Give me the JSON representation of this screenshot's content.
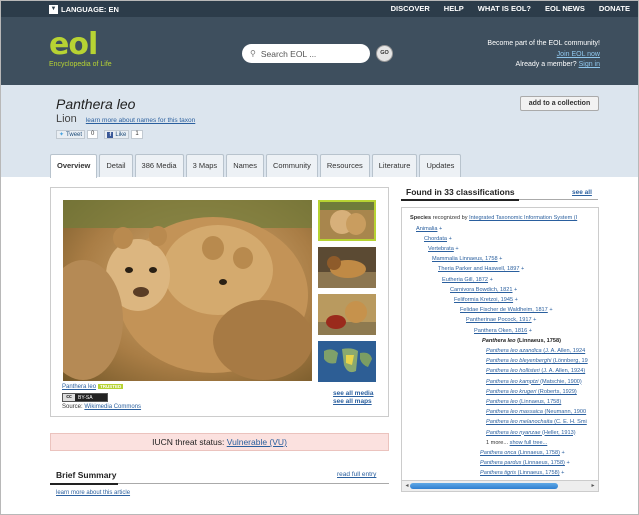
{
  "topbar": {
    "language_label": "LANGUAGE: EN",
    "nav": [
      "DISCOVER",
      "HELP",
      "WHAT IS EOL?",
      "EOL NEWS",
      "DONATE"
    ]
  },
  "banner": {
    "logo_word": "eol",
    "logo_tagline": "Encyclopedia of Life",
    "search_placeholder": "Search EOL ...",
    "go_label": "GO",
    "join_line1": "Become part of the EOL community!",
    "join_link": "Join EOL now",
    "member_prefix": "Already a member?",
    "signin_link": "Sign in"
  },
  "taxon": {
    "scientific_name": "Panthera leo",
    "common_name": "Lion",
    "names_link": "learn more about names for this taxon",
    "tweet_label": "Tweet",
    "tweet_count": "0",
    "like_label": "Like",
    "like_count": "1",
    "add_collection": "add to a collection"
  },
  "tabs": [
    "Overview",
    "Detail",
    "386 Media",
    "3 Maps",
    "Names",
    "Community",
    "Resources",
    "Literature",
    "Updates"
  ],
  "media": {
    "image_name": "Panthera leo",
    "trusted_badge": "TRUSTED",
    "license": "BY-SA",
    "cc_mark": "cc",
    "source_prefix": "Source:",
    "source_link": "Wikimedia Commons",
    "see_all_media": "see all media",
    "see_all_maps": "see all maps"
  },
  "iucn": {
    "label": "IUCN threat status:",
    "status": "Vulnerable (VU)"
  },
  "brief": {
    "title": "Brief Summary",
    "read_full": "read full entry",
    "learn_more": "learn more about this article"
  },
  "classifications": {
    "header": "Found in 33 classifications",
    "see_all": "see all",
    "species_prefix": "Species",
    "species_text": "recognized by",
    "species_link": "Integrated Taxonomic Information System (I",
    "tree": [
      {
        "text": "Animalia",
        "plus": "+"
      },
      {
        "text": "Chordata",
        "plus": "+"
      },
      {
        "text": "Vertebrata",
        "plus": "+"
      },
      {
        "text": "Mammalia Linnaeus, 1758",
        "plus": "+"
      },
      {
        "text": "Theria Parker and Haswell, 1897",
        "plus": "+"
      },
      {
        "text": "Eutheria Gill, 1872",
        "plus": "+"
      },
      {
        "text": "Carnivora Bowdich, 1821",
        "plus": "+"
      },
      {
        "text": "Feliformia Kretzoi, 1945",
        "plus": "+"
      },
      {
        "text": "Felidae Fischer de Waldheim, 1817",
        "plus": "+"
      },
      {
        "text": "Pantherinae Pocock, 1917",
        "plus": "+"
      },
      {
        "text": "Panthera Oken, 1816",
        "plus": "+"
      },
      {
        "text": "Panthera leo",
        "author": " (Linnaeus, 1758)"
      },
      {
        "text": "Panthera leo azandica",
        "author": " (J. A. Allen, 1924"
      },
      {
        "text": "Panthera leo bleyenberghi",
        "author": " (Lönnberg, 19"
      },
      {
        "text": "Panthera leo hollisteri",
        "author": " (J. A. Allen, 1924)"
      },
      {
        "text": "Panthera leo kamptzi",
        "author": " (Matschie, 1900)"
      },
      {
        "text": "Panthera leo krugeri",
        "author": " (Roberts, 1929)"
      },
      {
        "text": "Panthera leo",
        "author": " (Linnaeus, 1758)"
      },
      {
        "text": "Panthera leo massaica",
        "author": " (Neumann, 1900"
      },
      {
        "text": "Panthera leo melanochaita",
        "author": " (C. E. H. Smi"
      },
      {
        "text": "Panthera leo nyanzae",
        "author": " (Heller, 1913)"
      },
      {
        "text": "1 more...",
        "link": "show full tree..."
      },
      {
        "text": "Panthera onca",
        "author": " (Linnaeus, 1758)",
        "plus": "+"
      },
      {
        "text": "Panthera pardus",
        "author": " (Linnaeus, 1758)",
        "plus": "+"
      },
      {
        "text": "Panthera tigris",
        "author": " (Linnaeus, 1758)",
        "plus": "+"
      }
    ]
  },
  "colors": {
    "topbar": "#2c3c4a",
    "banner": "#3e4f5e",
    "brand_green": "#b7d333",
    "taxon_band": "#dce5ee",
    "link": "#2a5f9e",
    "iucn_bg": "#fbe1df"
  }
}
